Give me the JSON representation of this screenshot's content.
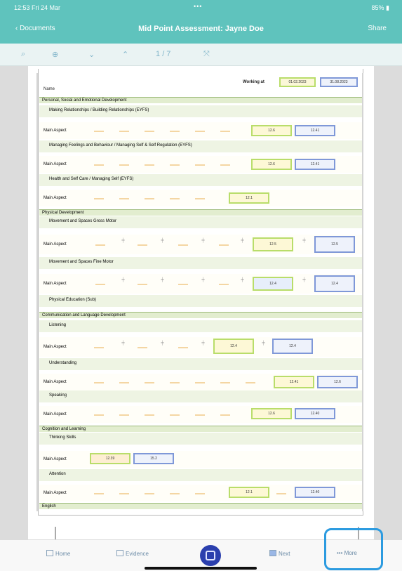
{
  "status": {
    "time": "12:53  Fri 24 Mar",
    "dots": "•••",
    "battery": "85% ▮"
  },
  "nav": {
    "back_label": "Documents",
    "title": "Mid Point Assessment: Jayne Doe",
    "share_label": "Share"
  },
  "toolbar": {
    "page_indicator": "1",
    "page_total": "/ 7",
    "icons": [
      "search-icon",
      "zoom-icon",
      "chevron-down-icon",
      "chevron-up-icon",
      "page-indicator",
      "expand-icon"
    ]
  },
  "doc": {
    "name_label": "Name",
    "working_at_label": "Working at",
    "date_green": "01.02.2023",
    "date_blue": "31.08.2023",
    "sections": [
      {
        "title": "Personal, Social and Emotional Development"
      },
      {
        "title": "Physical Development"
      },
      {
        "title": "Communication and Language Development"
      },
      {
        "title": "Cognition and Learning"
      },
      {
        "title": "English"
      }
    ],
    "subsections": [
      "Making Relationships / Building Relationships (EYFS)",
      "Managing Feelings and Behaviour / Managing Self & Self Regulation (EYFS)",
      "Health and Self Care / Managing Self (EYFS)",
      "Movement and Spaces Gross Motor",
      "Movement and Spaces Fine Motor",
      "Physical Education (Sub)",
      "Listening",
      "Understanding",
      "Speaking",
      "Thinking Skills",
      "Attention"
    ],
    "aspect_label": "Main Aspect",
    "values": {
      "r1_g": "12.6",
      "r1_b": "12.41",
      "r2_g": "12.6",
      "r2_b": "12.41",
      "r3_g": "12.1",
      "r4_g": "12.5",
      "r4_b": "12.5",
      "r5_g": "12.4",
      "r5_b": "12.4",
      "r6_g": "12.4",
      "r6_b": "12.4",
      "r7_g": "12.41",
      "r7_b": "12.6",
      "r8_g": "12.6",
      "r8_b": "12.40",
      "r9_o": "12.39",
      "r9_g": "15.2",
      "r10_g": "12.1",
      "r10_b": "12.40"
    }
  },
  "tabbar": {
    "home": "Home",
    "evidence": "Evidence",
    "next": "Next",
    "more": "More"
  }
}
